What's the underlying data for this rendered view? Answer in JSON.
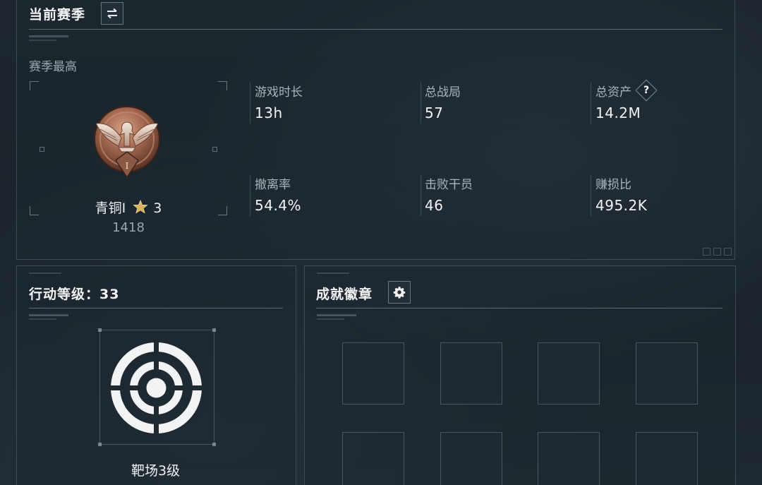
{
  "season_panel": {
    "title": "当前赛季",
    "switch_icon": "swap-arrows-icon",
    "section_label": "赛季最高",
    "rank": {
      "tier_name": "青铜I",
      "star_icon": "star-icon",
      "stars": "3",
      "score": "1418",
      "emblem_icon": "bronze-eagle-rank-emblem",
      "emblem_numeral": "I"
    },
    "stats": [
      {
        "label": "游戏时长",
        "value": "13h"
      },
      {
        "label": "总战局",
        "value": "57"
      },
      {
        "label": "总资产",
        "value": "14.2M",
        "help": "?"
      },
      {
        "label": "撤离率",
        "value": "54.4%"
      },
      {
        "label": "击败干员",
        "value": "46"
      },
      {
        "label": "赚损比",
        "value": "495.2K"
      }
    ]
  },
  "level_panel": {
    "title": "行动等级：33",
    "target_icon": "target-range-icon",
    "caption": "靶场3级"
  },
  "badge_panel": {
    "title": "成就徽章",
    "settings_icon": "gear-icon",
    "slots": 8
  },
  "colors": {
    "background": "#1b242c",
    "panel_border": "#96aab9",
    "text_primary": "#f2f4f5",
    "text_secondary": "#9aa6ae",
    "bronze": "#a86e55",
    "star_gold": "#d9b25a"
  }
}
